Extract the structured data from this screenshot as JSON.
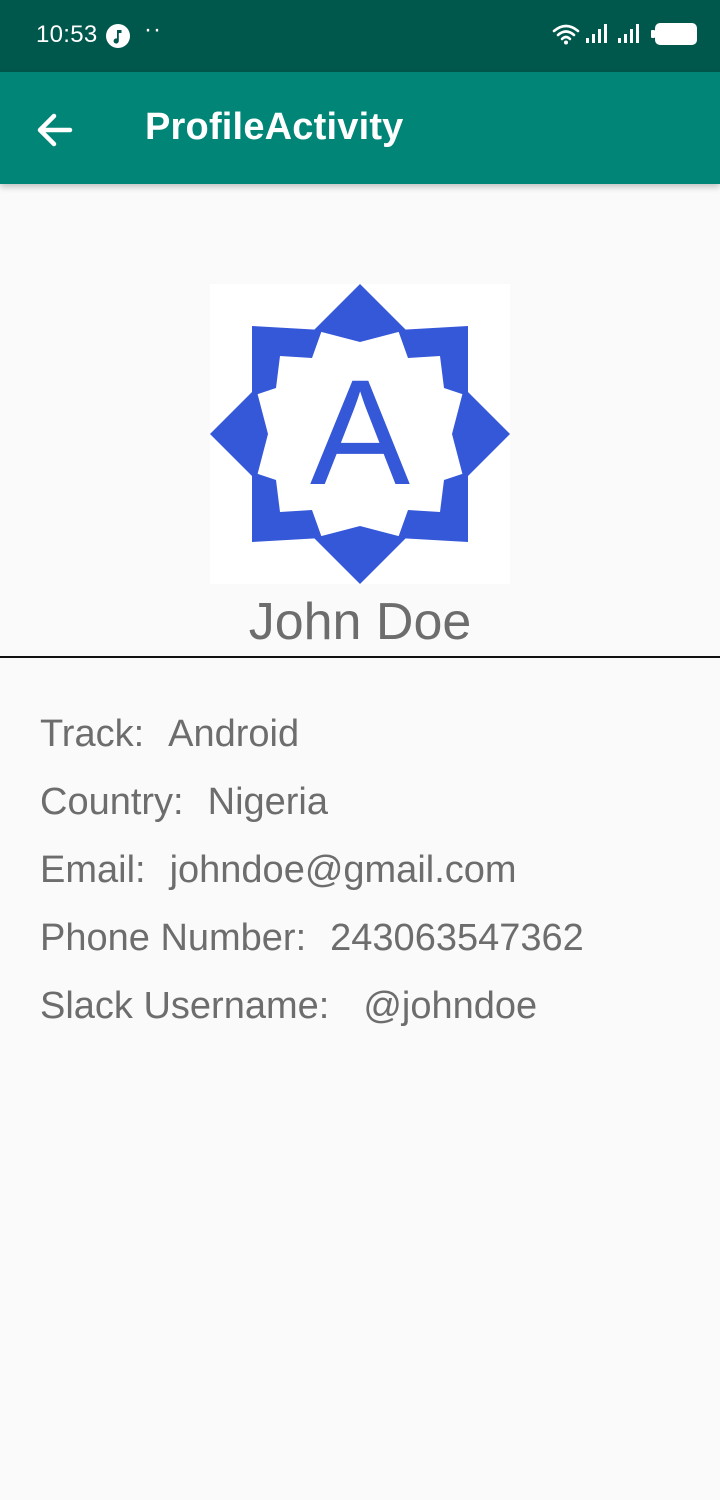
{
  "status_bar": {
    "time": "10:53",
    "dots": "··",
    "icons": [
      "music-note-icon",
      "wifi-icon",
      "signal-icon",
      "signal-icon",
      "battery-icon"
    ]
  },
  "app_bar": {
    "title": "ProfileActivity",
    "back_icon": "arrow-back-icon",
    "color": "#008577"
  },
  "profile": {
    "logo_letter": "A",
    "logo_color": "#3558d8",
    "name": "John Doe"
  },
  "details": [
    {
      "label": "Track:",
      "value": "Android"
    },
    {
      "label": "Country:",
      "value": "Nigeria"
    },
    {
      "label": "Email:",
      "value": "johndoe@gmail.com"
    },
    {
      "label": "Phone Number:",
      "value": "243063547362"
    },
    {
      "label": "Slack Username:",
      "value": "@johndoe"
    }
  ]
}
